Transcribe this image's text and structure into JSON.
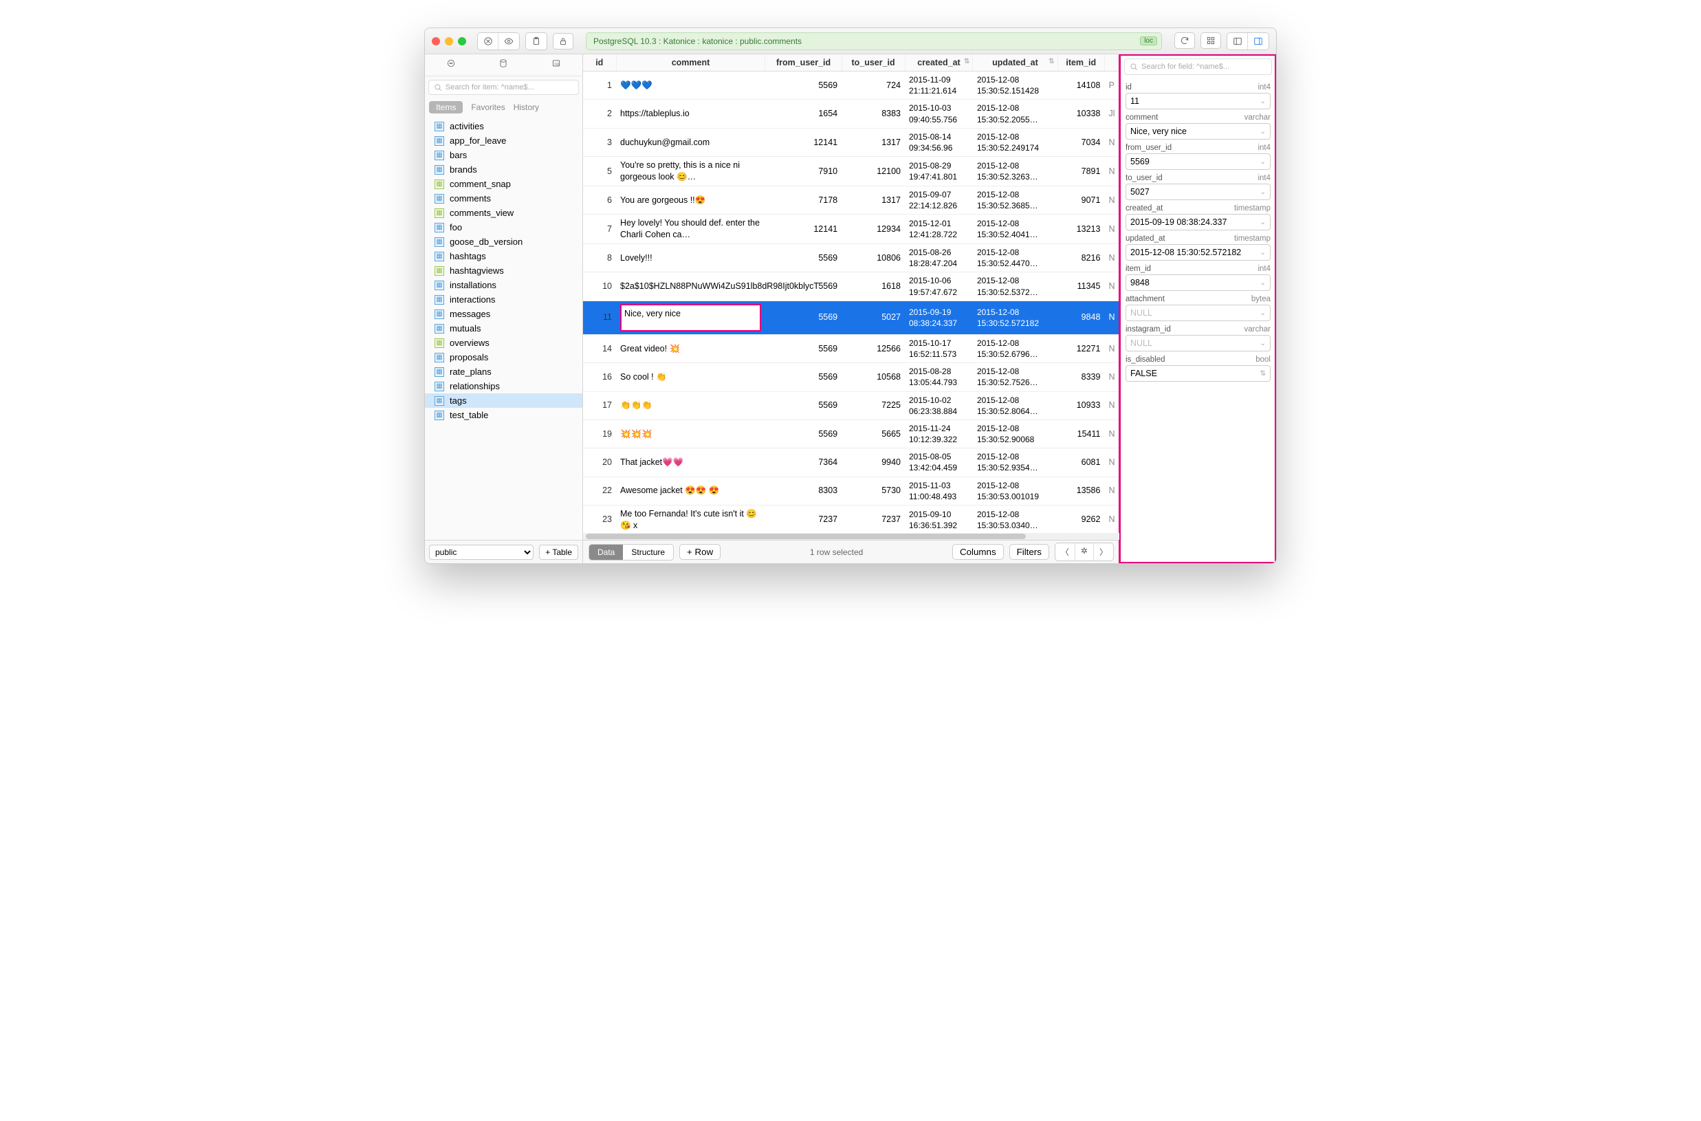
{
  "toolbar": {
    "breadcrumb": "PostgreSQL 10.3 : Katonice : katonice : public.comments",
    "loc_badge": "loc"
  },
  "sidebar": {
    "search_placeholder": "Search for item: ^name$...",
    "tabs": {
      "items": "Items",
      "favorites": "Favorites",
      "history": "History"
    },
    "tables": [
      {
        "name": "activities",
        "kind": "table"
      },
      {
        "name": "app_for_leave",
        "kind": "table"
      },
      {
        "name": "bars",
        "kind": "table"
      },
      {
        "name": "brands",
        "kind": "table"
      },
      {
        "name": "comment_snap",
        "kind": "view"
      },
      {
        "name": "comments",
        "kind": "table"
      },
      {
        "name": "comments_view",
        "kind": "view"
      },
      {
        "name": "foo",
        "kind": "table"
      },
      {
        "name": "goose_db_version",
        "kind": "table"
      },
      {
        "name": "hashtags",
        "kind": "table"
      },
      {
        "name": "hashtagviews",
        "kind": "view"
      },
      {
        "name": "installations",
        "kind": "table"
      },
      {
        "name": "interactions",
        "kind": "table"
      },
      {
        "name": "messages",
        "kind": "table"
      },
      {
        "name": "mutuals",
        "kind": "table"
      },
      {
        "name": "overviews",
        "kind": "view"
      },
      {
        "name": "proposals",
        "kind": "table"
      },
      {
        "name": "rate_plans",
        "kind": "table"
      },
      {
        "name": "relationships",
        "kind": "table"
      },
      {
        "name": "tags",
        "kind": "table",
        "selected": true
      },
      {
        "name": "test_table",
        "kind": "table"
      }
    ],
    "schema": "public",
    "add_table": "+ Table"
  },
  "grid": {
    "columns": [
      "id",
      "comment",
      "from_user_id",
      "to_user_id",
      "created_at",
      "updated_at",
      "item_id",
      ""
    ],
    "rows": [
      {
        "id": 1,
        "comment": "💙💙💙",
        "from": 5569,
        "to": 724,
        "created": "2015-11-09\n21:11:21.614",
        "updated": "2015-12-08\n15:30:52.151428",
        "item": 14108,
        "last": "P"
      },
      {
        "id": 2,
        "comment": "https://tableplus.io",
        "from": 1654,
        "to": 8383,
        "created": "2015-10-03\n09:40:55.756",
        "updated": "2015-12-08\n15:30:52.2055…",
        "item": 10338,
        "last": "Jl"
      },
      {
        "id": 3,
        "comment": "duchuykun@gmail.com",
        "from": 12141,
        "to": 1317,
        "created": "2015-08-14\n09:34:56.96",
        "updated": "2015-12-08\n15:30:52.249174",
        "item": 7034,
        "last": "N"
      },
      {
        "id": 5,
        "comment": "You're so pretty, this is a nice ni gorgeous look 😊…",
        "from": 7910,
        "to": 12100,
        "created": "2015-08-29\n19:47:41.801",
        "updated": "2015-12-08\n15:30:52.3263…",
        "item": 7891,
        "last": "N"
      },
      {
        "id": 6,
        "comment": "You are gorgeous !!😍",
        "from": 7178,
        "to": 1317,
        "created": "2015-09-07\n22:14:12.826",
        "updated": "2015-12-08\n15:30:52.3685…",
        "item": 9071,
        "last": "N"
      },
      {
        "id": 7,
        "comment": "Hey lovely! You should def. enter the Charli Cohen ca…",
        "from": 12141,
        "to": 12934,
        "created": "2015-12-01\n12:41:28.722",
        "updated": "2015-12-08\n15:30:52.4041…",
        "item": 13213,
        "last": "N"
      },
      {
        "id": 8,
        "comment": "Lovely!!!",
        "from": 5569,
        "to": 10806,
        "created": "2015-08-26\n18:28:47.204",
        "updated": "2015-12-08\n15:30:52.4470…",
        "item": 8216,
        "last": "N"
      },
      {
        "id": 10,
        "comment": "$2a$10$HZLN88PNuWWi4ZuS91lb8dR98Ijt0kblycT",
        "from": 5569,
        "to": 1618,
        "created": "2015-10-06\n19:57:47.672",
        "updated": "2015-12-08\n15:30:52.5372…",
        "item": 11345,
        "last": "N"
      },
      {
        "id": 11,
        "comment": "Nice, very nice",
        "from": 5569,
        "to": 5027,
        "created": "2015-09-19\n08:38:24.337",
        "updated": "2015-12-08\n15:30:52.572182",
        "item": 9848,
        "last": "N",
        "selected": true,
        "editing": true
      },
      {
        "id": 14,
        "comment": "Great video! 💥",
        "from": 5569,
        "to": 12566,
        "created": "2015-10-17\n16:52:11.573",
        "updated": "2015-12-08\n15:30:52.6796…",
        "item": 12271,
        "last": "N"
      },
      {
        "id": 16,
        "comment": "So cool ! 👏",
        "from": 5569,
        "to": 10568,
        "created": "2015-08-28\n13:05:44.793",
        "updated": "2015-12-08\n15:30:52.7526…",
        "item": 8339,
        "last": "N"
      },
      {
        "id": 17,
        "comment": "👏👏👏",
        "from": 5569,
        "to": 7225,
        "created": "2015-10-02\n06:23:38.884",
        "updated": "2015-12-08\n15:30:52.8064…",
        "item": 10933,
        "last": "N"
      },
      {
        "id": 19,
        "comment": "💥💥💥",
        "from": 5569,
        "to": 5665,
        "created": "2015-11-24\n10:12:39.322",
        "updated": "2015-12-08\n15:30:52.90068",
        "item": 15411,
        "last": "N"
      },
      {
        "id": 20,
        "comment": "That jacket💗💗",
        "from": 7364,
        "to": 9940,
        "created": "2015-08-05\n13:42:04.459",
        "updated": "2015-12-08\n15:30:52.9354…",
        "item": 6081,
        "last": "N"
      },
      {
        "id": 22,
        "comment": "Awesome jacket 😍😍 😍",
        "from": 8303,
        "to": 5730,
        "created": "2015-11-03\n11:00:48.493",
        "updated": "2015-12-08\n15:30:53.001019",
        "item": 13586,
        "last": "N"
      },
      {
        "id": 23,
        "comment": "Me too Fernanda! It's cute isn't it 😊😘 x",
        "from": 7237,
        "to": 7237,
        "created": "2015-09-10\n16:36:51.392",
        "updated": "2015-12-08\n15:30:53.0340…",
        "item": 9262,
        "last": "N"
      }
    ]
  },
  "footer": {
    "data": "Data",
    "structure": "Structure",
    "addrow": "+  Row",
    "status": "1 row selected",
    "columns": "Columns",
    "filters": "Filters"
  },
  "inspector": {
    "search_placeholder": "Search for field: ^name$...",
    "fields": [
      {
        "name": "id",
        "type": "int4",
        "value": "11"
      },
      {
        "name": "comment",
        "type": "varchar",
        "value": "Nice, very nice"
      },
      {
        "name": "from_user_id",
        "type": "int4",
        "value": "5569"
      },
      {
        "name": "to_user_id",
        "type": "int4",
        "value": "5027"
      },
      {
        "name": "created_at",
        "type": "timestamp",
        "value": "2015-09-19 08:38:24.337"
      },
      {
        "name": "updated_at",
        "type": "timestamp",
        "value": "2015-12-08 15:30:52.572182"
      },
      {
        "name": "item_id",
        "type": "int4",
        "value": "9848"
      },
      {
        "name": "attachment",
        "type": "bytea",
        "value": "NULL",
        "null": true
      },
      {
        "name": "instagram_id",
        "type": "varchar",
        "value": "NULL",
        "null": true
      },
      {
        "name": "is_disabled",
        "type": "bool",
        "value": "FALSE",
        "stepper": true
      }
    ]
  }
}
